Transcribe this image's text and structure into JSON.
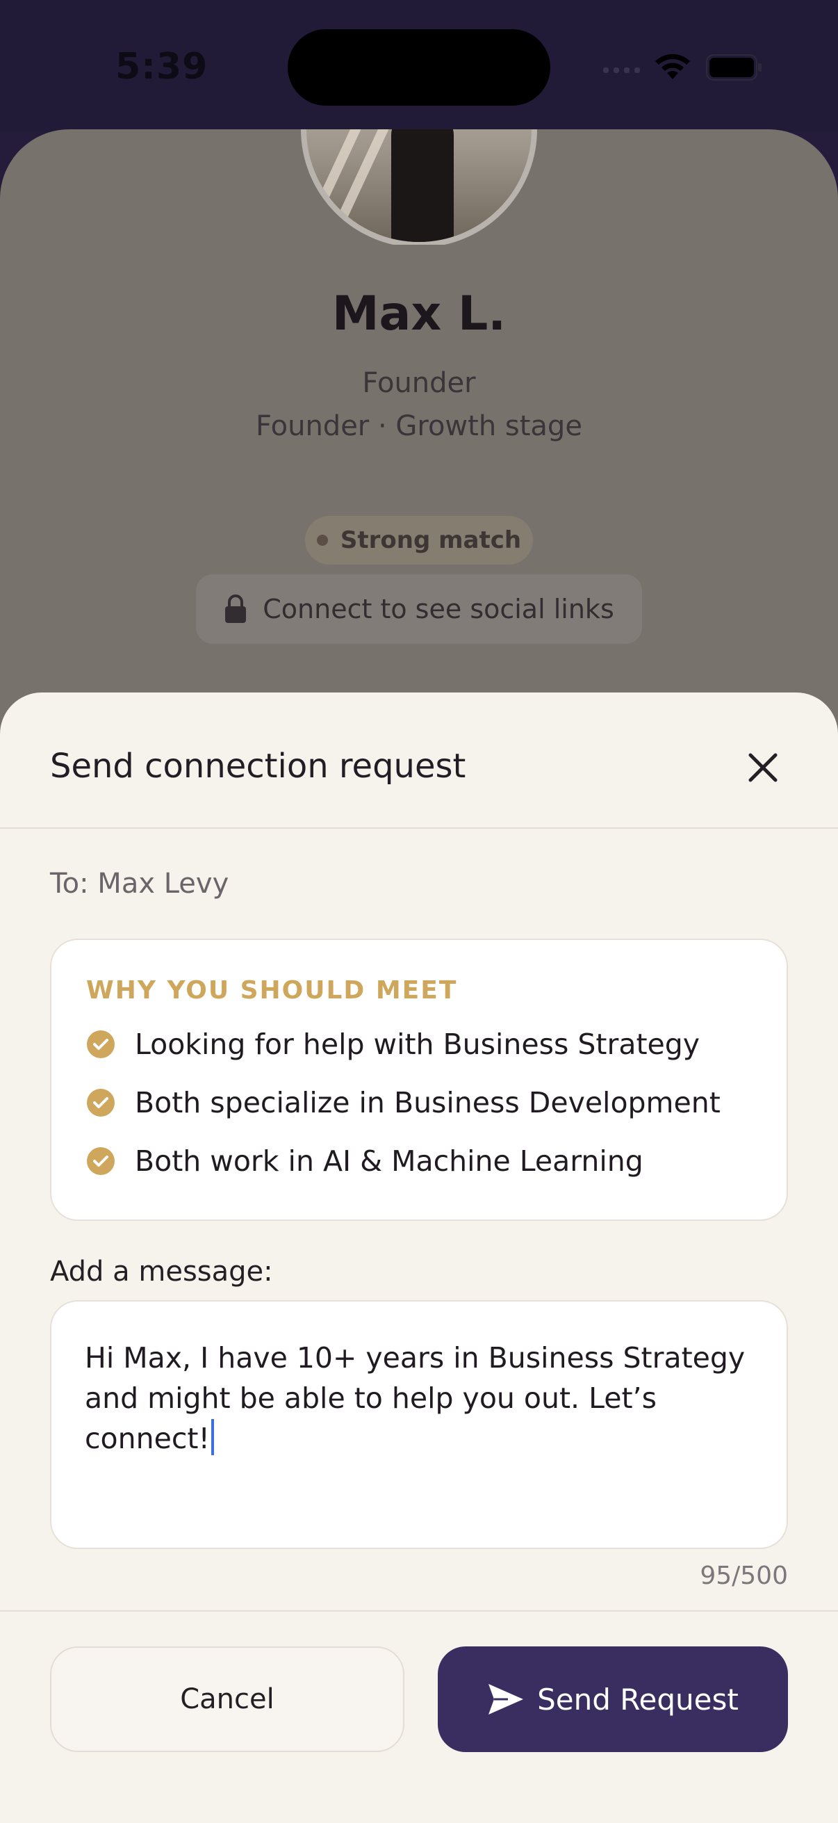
{
  "status_bar": {
    "time": "5:39"
  },
  "profile": {
    "name": "Max L.",
    "role": "Founder",
    "stage": "Founder · Growth stage",
    "match_badge": "Strong match",
    "social_note": "Connect to see social links"
  },
  "sheet": {
    "title": "Send connection request",
    "to_line": "To: Max Levy",
    "why_heading": "WHY YOU SHOULD MEET",
    "why_items": [
      "Looking for help with Business Strategy",
      "Both specialize in Business Development",
      "Both work in AI & Machine Learning"
    ],
    "message_label": "Add a message:",
    "message_text": "Hi Max, I have 10+ years in Business Strategy and might be able to help you out. Let’s connect!",
    "char_count": "95/500",
    "cancel_label": "Cancel",
    "send_label": "Send Request"
  },
  "colors": {
    "accent_gold": "#cfa75c",
    "primary_purple": "#3a2e61",
    "sheet_background": "#f6f2ec"
  },
  "icons": [
    "signal-icon",
    "wifi-icon",
    "battery-icon",
    "lock-icon",
    "close-icon",
    "check-icon",
    "send-icon"
  ]
}
